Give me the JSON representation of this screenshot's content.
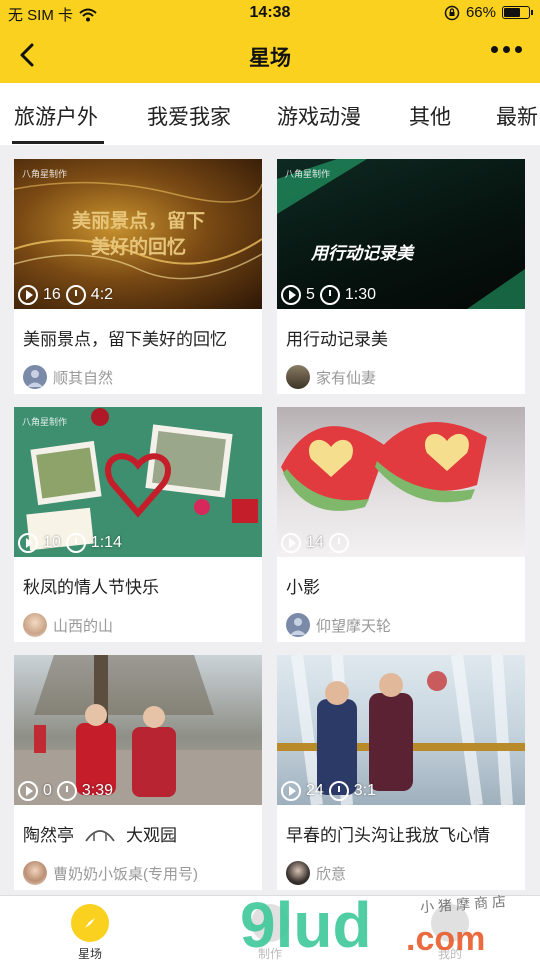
{
  "statusbar": {
    "carrier": "无 SIM 卡",
    "time": "14:38",
    "battery": "66%",
    "battery_level": 0.66
  },
  "nav": {
    "title": "星场",
    "back_icon": "chevron-left-icon",
    "more_icon": "more-dots-icon"
  },
  "tabs": [
    "旅游户外",
    "我爱我家",
    "游戏动漫",
    "其他",
    "最新"
  ],
  "active_tab": 0,
  "brand": "八角星制作",
  "cards": [
    {
      "title": "美丽景点，留下美好的回忆",
      "plays": "16",
      "duration": "4:2",
      "author": "顺其自然",
      "overlay": "美丽景点，留下\n美好的回忆"
    },
    {
      "title": "用行动记录美",
      "plays": "5",
      "duration": "1:30",
      "author": "家有仙妻",
      "overlay": "用行动记录美"
    },
    {
      "title": "秋凤的情人节快乐",
      "plays": "10",
      "duration": "1:14",
      "author": "山西的山"
    },
    {
      "title": "小影",
      "plays": "14",
      "duration": "",
      "author": "仰望摩天轮"
    },
    {
      "title": "陶然亭",
      "title_extra": "大观园",
      "plays": "0",
      "duration": "3:39",
      "author": "曹奶奶小饭桌(专用号)"
    },
    {
      "title": "早春的门头沟让我放飞心情",
      "plays": "24",
      "duration": "3:1",
      "author": "欣意"
    }
  ],
  "bottom": {
    "tab1": "星场",
    "tab2": "制作",
    "tab3": "我的"
  },
  "watermark": {
    "text": "9lud",
    "text2": ".com",
    "small": "小猪摩商店"
  },
  "colors": {
    "accent": "#f9d11e"
  }
}
